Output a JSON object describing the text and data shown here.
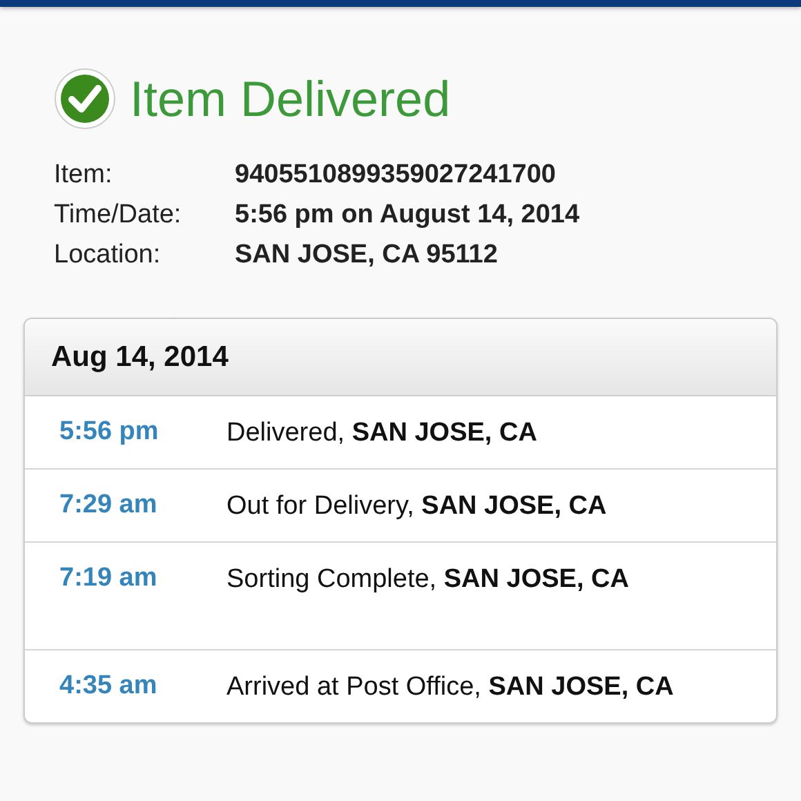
{
  "status": {
    "title": "Item Delivered"
  },
  "details": [
    {
      "label": "Item:",
      "value": "9405510899359027241700"
    },
    {
      "label": "Time/Date:",
      "value": "5:56 pm on August 14, 2014"
    },
    {
      "label": "Location:",
      "value": "SAN JOSE, CA 95112"
    }
  ],
  "history": {
    "date": "Aug 14, 2014",
    "events": [
      {
        "time": "5:56 pm",
        "description": "Delivered, **SAN JOSE, CA**"
      },
      {
        "time": "7:29 am",
        "description": "Out for Delivery, **SAN JOSE, CA**"
      },
      {
        "time": "7:19 am",
        "description": "Sorting Complete, **SAN JOSE, CA**"
      },
      {
        "time": "4:35 am",
        "description": "Arrived at Post Office, **SAN JOSE, CA**"
      }
    ]
  }
}
